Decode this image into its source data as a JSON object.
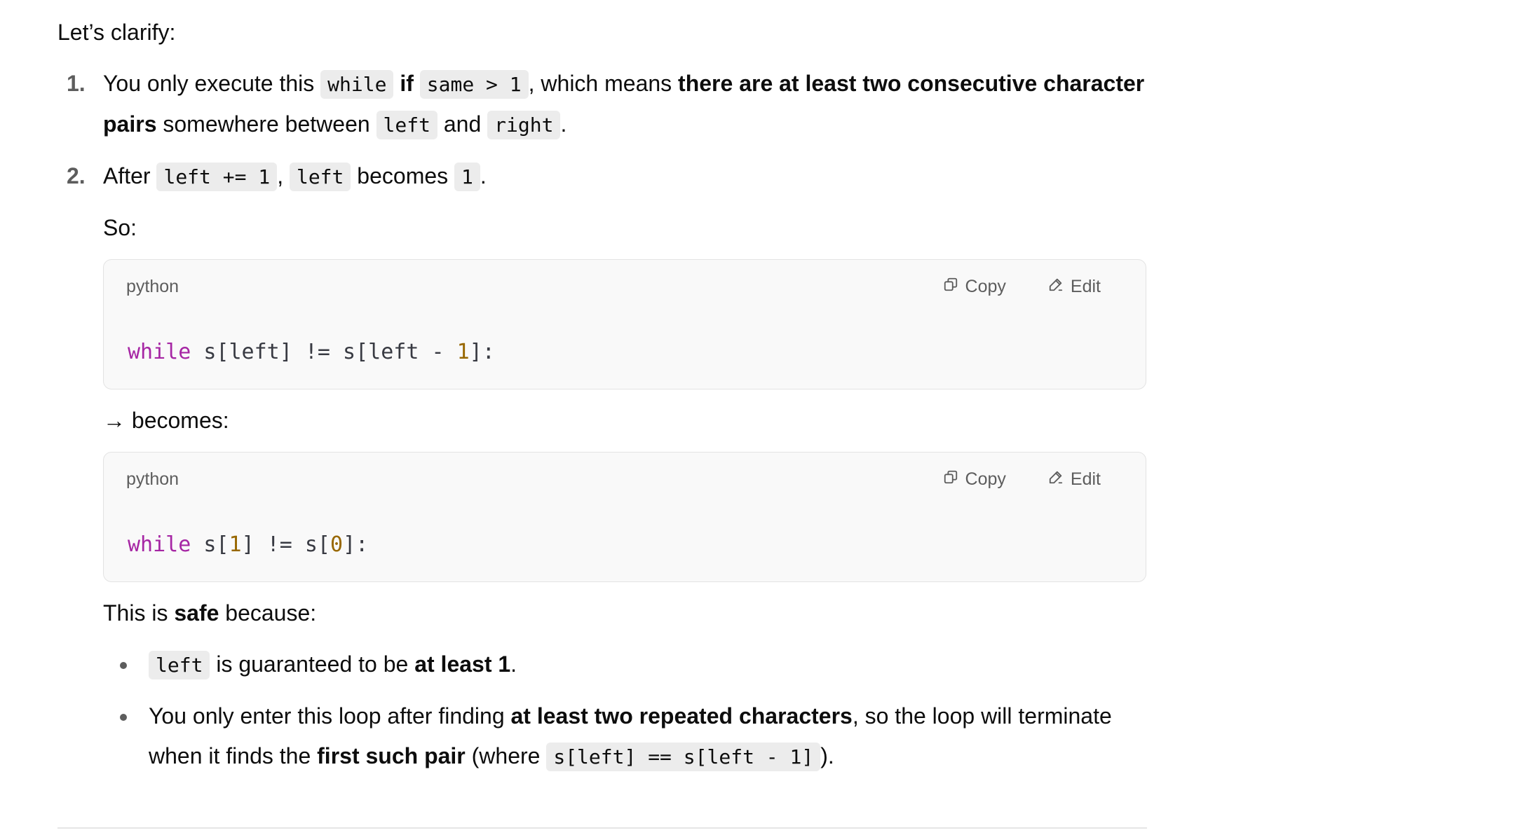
{
  "intro": "Let’s clarify:",
  "item1": {
    "num": "1.",
    "t1": "You only execute this ",
    "c1": "while",
    "b1": "if",
    "c2": "same > 1",
    "t2": ", which means ",
    "b2": "there are at least two consecutive character pairs",
    "t3": " somewhere between ",
    "c3": "left",
    "t4": " and ",
    "c4": "right",
    "t5": "."
  },
  "item2": {
    "num": "2.",
    "t1": "After ",
    "c1": "left += 1",
    "t2": ", ",
    "c2": "left",
    "t3": " becomes ",
    "c3": "1",
    "t4": ".",
    "so": "So:",
    "code1": {
      "lang": "python",
      "copy": "Copy",
      "edit": "Edit",
      "kw": "while",
      "p1": " s[left] != s[left - ",
      "n1": "1",
      "p2": "]:"
    },
    "becomes": "→ becomes:",
    "code2": {
      "lang": "python",
      "copy": "Copy",
      "edit": "Edit",
      "kw": "while",
      "p1": " s[",
      "n1": "1",
      "p2": "] != s[",
      "n2": "0",
      "p3": "]:"
    },
    "safe": {
      "t1": "This is ",
      "b1": "safe",
      "t2": " because:"
    },
    "bullets": [
      {
        "c1": "left",
        "t1": " is guaranteed to be ",
        "b1": "at least 1",
        "t2": "."
      },
      {
        "t1": "You only enter this loop after finding ",
        "b1": "at least two repeated characters",
        "t2": ", so the loop will terminate when it finds the ",
        "b2": "first such pair",
        "t3": " (where ",
        "c1": "s[left] == s[left - 1]",
        "t4": ")."
      }
    ]
  },
  "colors": {
    "keyword": "#a626a4",
    "number": "#986801",
    "code_bg": "#f9f9f9",
    "inline_code_bg": "#ececec"
  },
  "icons": {
    "copy": "copy-icon",
    "edit": "edit-pencil-icon"
  }
}
